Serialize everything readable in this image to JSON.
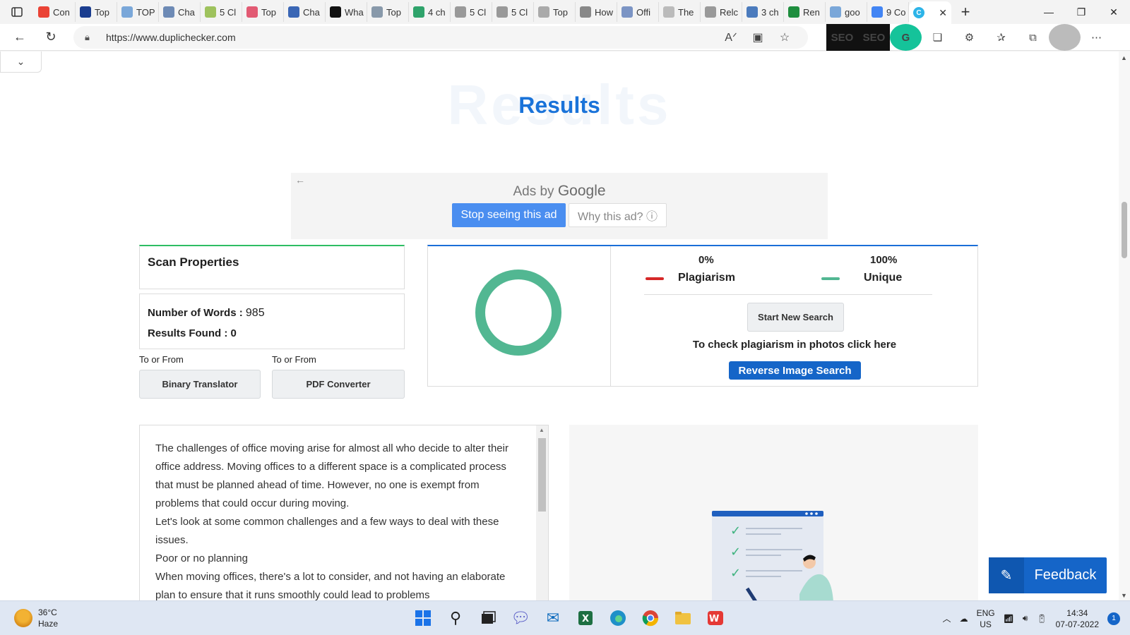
{
  "browser": {
    "tabs": [
      {
        "label": "Con",
        "color": "#ea4335"
      },
      {
        "label": "Top",
        "color": "#1a3d8f"
      },
      {
        "label": "TOP",
        "color": "#7aa7d9"
      },
      {
        "label": "Cha",
        "color": "#6d8ab5"
      },
      {
        "label": "5 Cl",
        "color": "#9ec25d"
      },
      {
        "label": "Top",
        "color": "#e25a73"
      },
      {
        "label": "Cha",
        "color": "#3a66b5"
      },
      {
        "label": "Wha",
        "color": "#111111"
      },
      {
        "label": "Top",
        "color": "#8899aa"
      },
      {
        "label": "4 ch",
        "color": "#2fa36b"
      },
      {
        "label": "5 Cl",
        "color": "#999999"
      },
      {
        "label": "5 Cl",
        "color": "#999999"
      },
      {
        "label": "Top",
        "color": "#aaaaaa"
      },
      {
        "label": "How",
        "color": "#888888"
      },
      {
        "label": "Offi",
        "color": "#7b94c4"
      },
      {
        "label": "The",
        "color": "#bbbbbb"
      },
      {
        "label": "Relc",
        "color": "#999999"
      },
      {
        "label": "3 ch",
        "color": "#4b7bbd"
      },
      {
        "label": "Ren",
        "color": "#1e8e3e"
      },
      {
        "label": "goo",
        "color": "#7aa7d9"
      },
      {
        "label": "9 Co",
        "color": "#4285f4"
      }
    ],
    "url": "https://www.duplichecker.com"
  },
  "page": {
    "results_watermark": "Results",
    "results_title": "Results",
    "ad": {
      "ads_by": "Ads by",
      "google": "Google",
      "stop_label": "Stop seeing this ad",
      "why_label": "Why this ad? ⓘ"
    },
    "scan": {
      "title": "Scan Properties",
      "words_label": "Number of Words : ",
      "words_value": "985",
      "results_label": "Results Found : 0"
    },
    "to_from": [
      {
        "label": "To or From",
        "button": "Binary Translator"
      },
      {
        "label": "To or From",
        "button": "PDF Converter"
      }
    ],
    "report": {
      "plagiarism_pct": "0%",
      "plagiarism_label": "Plagiarism",
      "plagiarism_color": "#d62828",
      "unique_pct": "100%",
      "unique_label": "Unique",
      "unique_color": "#52b792",
      "start_label": "Start New Search",
      "photo_note": "To check plagiarism in photos click here",
      "reverse_label": "Reverse Image Search"
    },
    "text_lines": [
      "The challenges of office moving arise for almost all who decide to alter their office address. Moving offices to a different space is a complicated process that must be planned ahead of time. However, no one is exempt from problems that could occur during moving.",
      "Let's look at some common challenges and a few ways to deal with these issues.",
      "Poor or no planning",
      "When moving offices, there's a lot to consider, and not having an elaborate plan to ensure that it runs smoothly could lead to problems"
    ],
    "feedback_label": "Feedback"
  },
  "taskbar": {
    "temp": "36°C",
    "weather": "Haze",
    "lang_top": "ENG",
    "lang_bottom": "US",
    "time": "14:34",
    "date": "07-07-2022",
    "notifications": "1"
  }
}
